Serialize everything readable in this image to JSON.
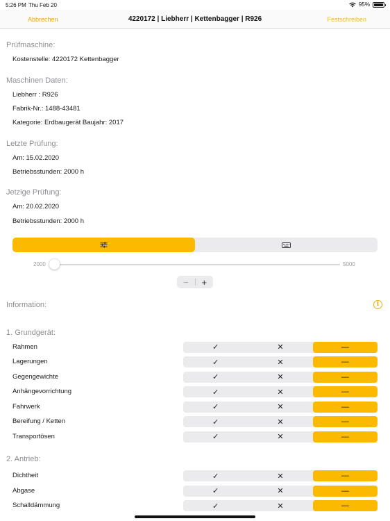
{
  "status": {
    "time": "5:26 PM",
    "date": "Thu Feb 20",
    "battery": "95%"
  },
  "nav": {
    "cancel": "Abbrechen",
    "title": "4220172 | Liebherr  | Kettenbagger | R926",
    "commit": "Festschreiben"
  },
  "sections": {
    "pruefmaschine": {
      "title": "Prüfmaschine:",
      "rows": [
        "Kostenstelle: 4220172 Kettenbagger"
      ]
    },
    "maschinen": {
      "title": "Maschinen Daten:",
      "rows": [
        "Liebherr : R926",
        "Fabrik-Nr.: 1488-43481",
        "Kategorie: Erdbaugerät Baujahr: 2017"
      ]
    },
    "letzte": {
      "title": "Letzte Prüfung:",
      "rows": [
        "Am: 15.02.2020",
        "Betriebsstunden: 2000 h"
      ]
    },
    "jetzige": {
      "title": "Jetzige Prüfung:",
      "rows": [
        "Am: 20.02.2020",
        "Betriebsstunden: 2000 h"
      ]
    }
  },
  "input_mode": {
    "options": [
      "sliders-icon",
      "keyboard-icon"
    ],
    "selected": 0
  },
  "slider": {
    "min_label": "2000",
    "max_label": "5000",
    "min": 2000,
    "max": 5000,
    "value": 2000
  },
  "stepper": {
    "minus": "−",
    "plus": "+"
  },
  "information": {
    "label": "Information:",
    "icon": "info-icon"
  },
  "check_symbols": {
    "ok": "✓",
    "fail": "✕",
    "na": "—"
  },
  "groups": [
    {
      "title": "1. Grundgerät:",
      "items": [
        {
          "label": "Rahmen",
          "selected": "na"
        },
        {
          "label": "Lagerungen",
          "selected": "na"
        },
        {
          "label": "Gegengewichte",
          "selected": "na"
        },
        {
          "label": "Anhängevorrichtung",
          "selected": "na"
        },
        {
          "label": "Fahrwerk",
          "selected": "na"
        },
        {
          "label": "Bereifung / Ketten",
          "selected": "na"
        },
        {
          "label": "Transportösen",
          "selected": "na"
        }
      ]
    },
    {
      "title": "2. Antrieb:",
      "items": [
        {
          "label": "Dichtheit",
          "selected": "na"
        },
        {
          "label": "Abgase",
          "selected": "na"
        },
        {
          "label": "Schalldämmung",
          "selected": "na"
        }
      ]
    }
  ],
  "colors": {
    "accent": "#fbb900",
    "section_title": "#8e8e93",
    "control_bg": "#ebebed"
  }
}
